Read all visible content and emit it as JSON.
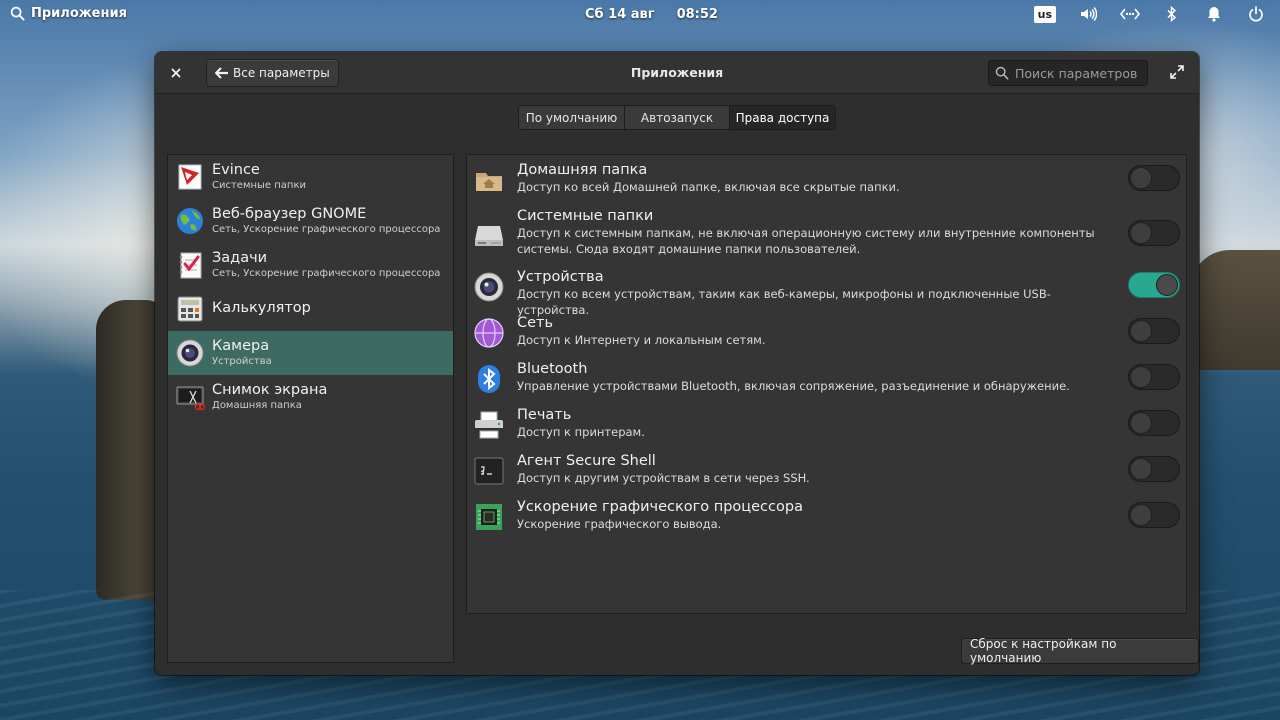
{
  "panel": {
    "apps_label": "Приложения",
    "date": "Сб 14 авг",
    "time": "08:52",
    "keyboard_layout": "us"
  },
  "window": {
    "title": "Приложения",
    "back_label": "Все параметры",
    "search_placeholder": "Поиск параметров"
  },
  "tabs": [
    {
      "label": "По умолчанию"
    },
    {
      "label": "Автозапуск"
    },
    {
      "label": "Права доступа",
      "active": true
    }
  ],
  "apps": [
    {
      "name": "Evince",
      "sub": "Системные папки",
      "icon": "evince-icon"
    },
    {
      "name": "Веб-браузер GNOME",
      "sub": "Сеть, Ускорение графического процессора",
      "icon": "web-browser-icon"
    },
    {
      "name": "Задачи",
      "sub": "Сеть, Ускорение графического процессора",
      "icon": "tasks-icon"
    },
    {
      "name": "Калькулятор",
      "sub": "",
      "icon": "calculator-icon"
    },
    {
      "name": "Камера",
      "sub": "Устройства",
      "icon": "camera-icon",
      "selected": true
    },
    {
      "name": "Снимок экрана",
      "sub": "Домашняя папка",
      "icon": "screenshot-icon"
    }
  ],
  "permissions": [
    {
      "title": "Домашняя папка",
      "desc": "Доступ ко всей Домашней папке, включая все скрытые папки.",
      "icon": "home-folder-icon",
      "enabled": false
    },
    {
      "title": "Системные папки",
      "desc": "Доступ к системным папкам, не включая операционную систему или внутренние компоненты системы. Сюда входят домашние папки пользователей.",
      "icon": "drive-icon",
      "enabled": false
    },
    {
      "title": "Устройства",
      "desc": "Доступ ко всем устройствам, таким как веб-камеры, микрофоны и подключенные USB-устройства.",
      "icon": "webcam-icon",
      "enabled": true
    },
    {
      "title": "Сеть",
      "desc": "Доступ к Интернету и локальным сетям.",
      "icon": "network-icon",
      "enabled": false
    },
    {
      "title": "Bluetooth",
      "desc": "Управление устройствами Bluetooth, включая сопряжение, разъединение и обнаружение.",
      "icon": "bluetooth-icon",
      "enabled": false
    },
    {
      "title": "Печать",
      "desc": "Доступ к принтерам.",
      "icon": "printer-icon",
      "enabled": false
    },
    {
      "title": "Агент Secure Shell",
      "desc": "Доступ к другим устройствам в сети через SSH.",
      "icon": "terminal-icon",
      "enabled": false
    },
    {
      "title": "Ускорение графического процессора",
      "desc": "Ускорение графического вывода.",
      "icon": "gpu-icon",
      "enabled": false
    }
  ],
  "reset_label": "Сброс к настройкам по умолчанию",
  "colors": {
    "accent": "#2aa88f",
    "selected_row": "#3d6b62",
    "window_bg": "#2e2e2e"
  }
}
